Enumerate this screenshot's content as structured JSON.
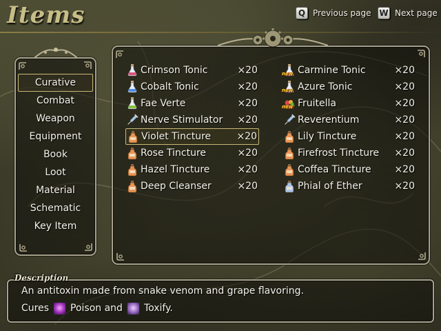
{
  "header": {
    "title": "Items",
    "prev": {
      "key": "Q",
      "label": "Previous page"
    },
    "next": {
      "key": "W",
      "label": "Next page"
    }
  },
  "categories": [
    {
      "label": "Curative",
      "selected": true
    },
    {
      "label": "Combat",
      "selected": false
    },
    {
      "label": "Weapon",
      "selected": false
    },
    {
      "label": "Equipment",
      "selected": false
    },
    {
      "label": "Book",
      "selected": false
    },
    {
      "label": "Loot",
      "selected": false
    },
    {
      "label": "Material",
      "selected": false
    },
    {
      "label": "Schematic",
      "selected": false
    },
    {
      "label": "Key Item",
      "selected": false
    }
  ],
  "items": {
    "left": [
      {
        "name": "Crimson Tonic",
        "qty": "×20",
        "icon": "red-potion-icon",
        "color": "#e0507a",
        "shape": "flask",
        "new": false
      },
      {
        "name": "Cobalt Tonic",
        "qty": "×20",
        "icon": "blue-potion-icon",
        "color": "#4f8de8",
        "shape": "flask",
        "new": false
      },
      {
        "name": "Fae Verte",
        "qty": "×20",
        "icon": "green-potion-icon",
        "color": "#86c43a",
        "shape": "flask",
        "new": false
      },
      {
        "name": "Nerve Stimulator",
        "qty": "×20",
        "icon": "syringe-icon",
        "color": "#a6c8e8",
        "shape": "syringe",
        "new": false
      },
      {
        "name": "Violet Tincture",
        "qty": "×20",
        "icon": "tincture-bottle-icon",
        "color": "#e89555",
        "shape": "bottle",
        "new": false,
        "selected": true
      },
      {
        "name": "Rose Tincture",
        "qty": "×20",
        "icon": "tincture-bottle-icon",
        "color": "#e89555",
        "shape": "bottle",
        "new": false
      },
      {
        "name": "Hazel Tincture",
        "qty": "×20",
        "icon": "tincture-bottle-icon",
        "color": "#e89555",
        "shape": "bottle",
        "new": false
      },
      {
        "name": "Deep Cleanser",
        "qty": "×20",
        "icon": "tincture-bottle-icon",
        "color": "#e89555",
        "shape": "bottle",
        "new": false
      }
    ],
    "right": [
      {
        "name": "Carmine Tonic",
        "qty": "×20",
        "icon": "red-potion-icon",
        "color": "#e0507a",
        "shape": "flask",
        "new": true
      },
      {
        "name": "Azure Tonic",
        "qty": "×20",
        "icon": "blue-potion-icon",
        "color": "#4f8de8",
        "shape": "flask",
        "new": true
      },
      {
        "name": "Fruitella",
        "qty": "×20",
        "icon": "fruit-basket-icon",
        "color": "#d94848",
        "shape": "fruit",
        "new": true
      },
      {
        "name": "Reverentium",
        "qty": "×20",
        "icon": "syringe-icon",
        "color": "#a6c8e8",
        "shape": "syringe",
        "new": false
      },
      {
        "name": "Lily Tincture",
        "qty": "×20",
        "icon": "tincture-bottle-icon",
        "color": "#e89555",
        "shape": "bottle",
        "new": false
      },
      {
        "name": "Firefrost Tincture",
        "qty": "×20",
        "icon": "tincture-bottle-icon",
        "color": "#e89555",
        "shape": "bottle",
        "new": false
      },
      {
        "name": "Coffea Tincture",
        "qty": "×20",
        "icon": "tincture-bottle-icon",
        "color": "#e89555",
        "shape": "bottle",
        "new": false
      },
      {
        "name": "Phial of Ether",
        "qty": "×20",
        "icon": "phial-icon",
        "color": "#a9c4ea",
        "shape": "bottle",
        "new": false
      }
    ],
    "new_badge": "new"
  },
  "description": {
    "label": "Description",
    "line1": "An antitoxin made from snake venom and grape flavoring.",
    "line2_prefix": "Cures",
    "status1": "Poison and",
    "status2": "Toxify."
  },
  "colors": {
    "title": "#c6bd87",
    "frame": "#a7a38e",
    "highlight": "#cbb878"
  }
}
